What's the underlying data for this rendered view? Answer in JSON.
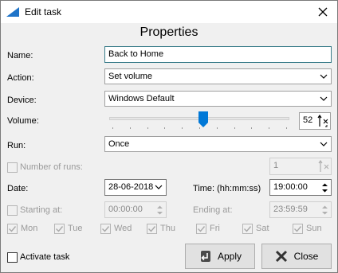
{
  "window": {
    "title": "Edit task"
  },
  "heading": "Properties",
  "name": {
    "label": "Name:",
    "value": "Back to Home"
  },
  "action": {
    "label": "Action:",
    "value": "Set volume"
  },
  "device": {
    "label": "Device:",
    "value": "Windows Default"
  },
  "volume": {
    "label": "Volume:",
    "value": "52",
    "level": 0.52
  },
  "run": {
    "label": "Run:",
    "value": "Once"
  },
  "runs": {
    "label": "Number of runs:",
    "value": "1"
  },
  "date": {
    "label": "Date:",
    "value": "28-06-2018"
  },
  "time": {
    "label": "Time: (hh:mm:ss)",
    "value": "19:00:00"
  },
  "starting": {
    "label": "Starting at:",
    "value": "00:00:00"
  },
  "ending": {
    "label": "Ending at:",
    "value": "23:59:59"
  },
  "days": [
    {
      "label": "Mon",
      "checked": true
    },
    {
      "label": "Tue",
      "checked": true
    },
    {
      "label": "Wed",
      "checked": true
    },
    {
      "label": "Thu",
      "checked": true
    },
    {
      "label": "Fri",
      "checked": true
    },
    {
      "label": "Sat",
      "checked": true
    },
    {
      "label": "Sun",
      "checked": true
    }
  ],
  "activate": {
    "label": "Activate task",
    "checked": false
  },
  "buttons": {
    "apply": "Apply",
    "close": "Close"
  },
  "colors": {
    "accent": "#0078d7",
    "slider_thumb": "#0078d7",
    "disabled_text": "#9a9a9a"
  }
}
